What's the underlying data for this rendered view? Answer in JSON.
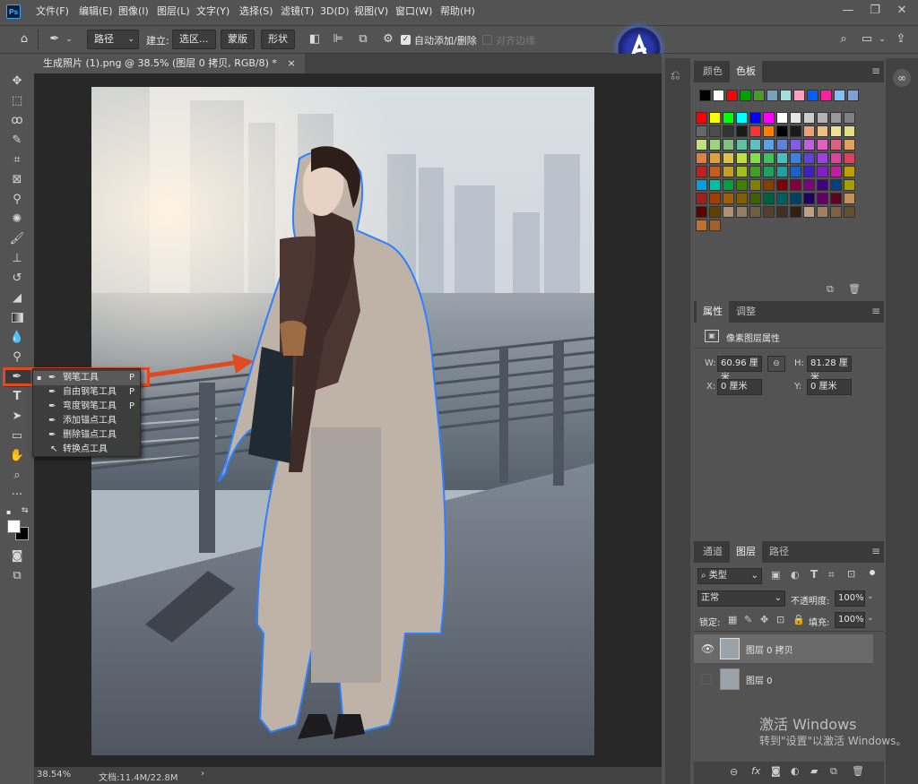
{
  "app": {
    "logo": "Ps"
  },
  "menu": [
    "文件(F)",
    "编辑(E)",
    "图像(I)",
    "图层(L)",
    "文字(Y)",
    "选择(S)",
    "滤镜(T)",
    "3D(D)",
    "视图(V)",
    "窗口(W)",
    "帮助(H)"
  ],
  "window_controls": [
    "—",
    "❐",
    "✕"
  ],
  "options": {
    "mode_value": "路径",
    "build_label": "建立:",
    "selection_btn": "选区...",
    "mask_btn": "蒙版",
    "shape_btn": "形状",
    "auto_add_label": "自动添加/删除",
    "auto_add_checked": true,
    "align_edges_label": "对齐边缘"
  },
  "document": {
    "tab_title": "生成照片 (1).png @ 38.5% (图层 0 拷贝, RGB/8) *",
    "close": "×"
  },
  "status": {
    "zoom": "38.54%",
    "doc": "文档:11.4M/22.8M",
    "arrow": "›"
  },
  "tools": [
    "move-tool",
    "marquee-tool",
    "lasso-tool",
    "quick-select-tool",
    "crop-tool",
    "frame-tool",
    "eyedropper-tool",
    "spot-heal-tool",
    "brush-tool",
    "stamp-tool",
    "history-brush-tool",
    "eraser-tool",
    "gradient-tool",
    "blur-tool",
    "dodge-tool",
    "pen-tool",
    "type-tool",
    "path-select-tool",
    "rectangle-tool",
    "hand-tool",
    "zoom-tool",
    "more-tool"
  ],
  "pen_flyout": [
    {
      "label": "钢笔工具",
      "key": "P",
      "selected": true
    },
    {
      "label": "自由钢笔工具",
      "key": "P"
    },
    {
      "label": "弯度钢笔工具",
      "key": "P"
    },
    {
      "label": "添加锚点工具",
      "key": ""
    },
    {
      "label": "删除锚点工具",
      "key": ""
    },
    {
      "label": "转换点工具",
      "key": ""
    }
  ],
  "color_panel": {
    "tabs": [
      "颜色",
      "色板"
    ],
    "active": 1
  },
  "properties_panel": {
    "tabs": [
      "属性",
      "调整"
    ],
    "active": 0,
    "title": "像素图层属性",
    "w_label": "W:",
    "w_value": "60.96 厘米",
    "h_label": "H:",
    "h_value": "81.28 厘米",
    "x_label": "X:",
    "x_value": "0 厘米",
    "y_label": "Y:",
    "y_value": "0 厘米"
  },
  "layers_panel": {
    "tabs": [
      "通道",
      "图层",
      "路径"
    ],
    "active": 1,
    "filter_kind": "类型",
    "blend_mode": "正常",
    "opacity_label": "不透明度:",
    "opacity_value": "100%",
    "lock_label": "锁定:",
    "fill_label": "填充:",
    "fill_value": "100%",
    "layers": [
      {
        "name": "图层 0 拷贝",
        "visible": true,
        "selected": true
      },
      {
        "name": "图层 0",
        "visible": false,
        "selected": false
      }
    ],
    "footer_icons": [
      "link-icon",
      "fx-icon",
      "mask-icon",
      "adjustment-icon",
      "group-icon",
      "new-layer-icon",
      "trash-icon"
    ],
    "fx_label": "fx"
  },
  "watermark": {
    "line1": "激活 Windows",
    "line2": "转到\"设置\"以激活 Windows。"
  },
  "colors": {
    "accent": "#31a8ff",
    "highlight": "#e04a22",
    "selection": "#2f80ff"
  }
}
